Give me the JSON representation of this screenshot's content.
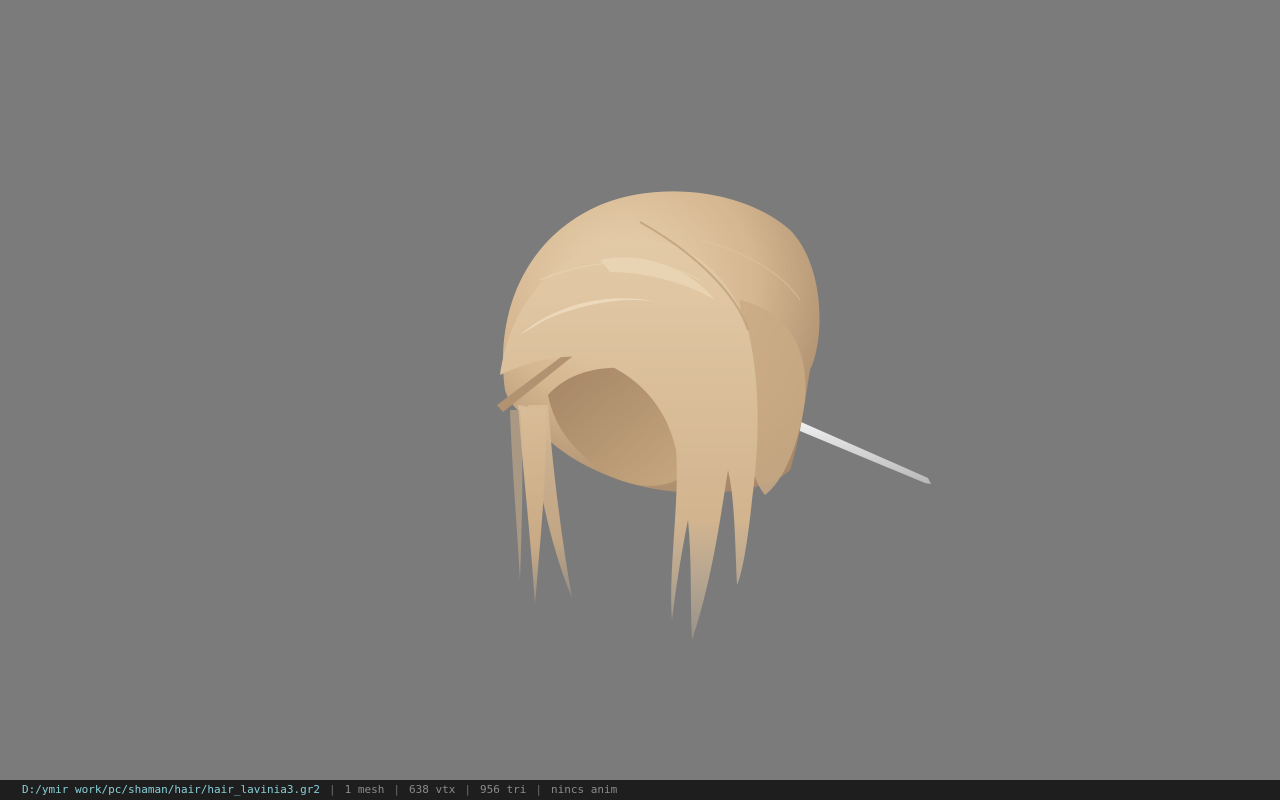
{
  "viewer": {
    "background_color": "#7b7b7b",
    "model": {
      "name": "hair-mesh",
      "hair_color": "#d8bb97",
      "hair_shadow_color": "#a88b66",
      "stick_color": "#e6e6e6"
    }
  },
  "status_bar": {
    "background_color": "#1e1e1e",
    "path_color": "#86cdd6",
    "file_path": "D:/ymir work/pc/shaman/hair/hair_lavinia3.gr2",
    "separator": "|",
    "mesh_count": "1 mesh",
    "vertex_count": "638 vtx",
    "triangle_count": "956 tri",
    "anim_status": "nincs anim"
  }
}
